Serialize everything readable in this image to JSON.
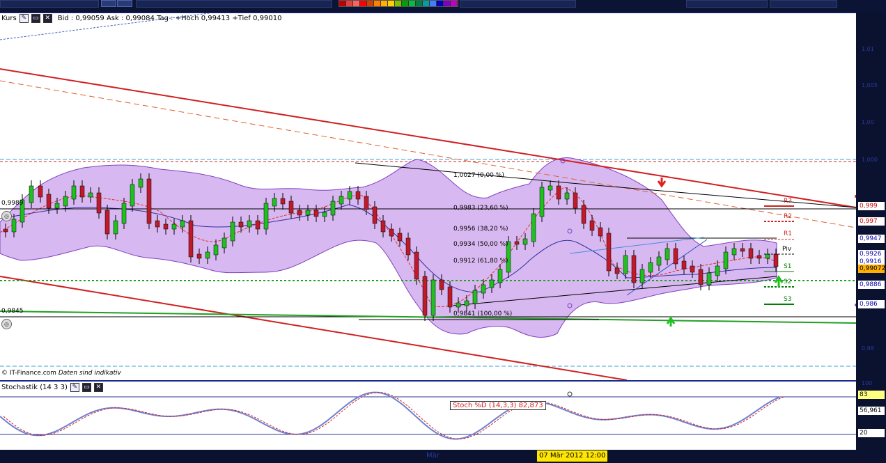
{
  "header": {
    "pane_title": "Kurs",
    "ohlc_text": "Bid : 0,99059 Ask : 0,99084  Tag : +Hoch 0,99413 +Tief 0,99010"
  },
  "icons": [
    "wrench-icon",
    "window-icon",
    "close-icon"
  ],
  "palette_colors": [
    "#c00000",
    "#e04040",
    "#ff6060",
    "#ff0000",
    "#d04000",
    "#ff8000",
    "#ffb000",
    "#ffd000",
    "#80c000",
    "#00a000",
    "#00c040",
    "#008040",
    "#00a0a0",
    "#4080ff",
    "#0000c0",
    "#8000c0",
    "#c000c0"
  ],
  "chart": {
    "price_labels": [
      {
        "text": "0,9989",
        "key": "left_9989"
      },
      {
        "text": "0,9845",
        "key": "left_9845"
      }
    ],
    "fibonacci": [
      {
        "label": "1,0027 (0,00 %)"
      },
      {
        "label": "0,9983 (23,60 %)"
      },
      {
        "label": "0,9956 (38,20 %)"
      },
      {
        "label": "0,9934 (50,00 %)"
      },
      {
        "label": "0,9912 (61,80 %)"
      },
      {
        "label": "0,9841 (100,00 %)"
      }
    ],
    "pivots": [
      {
        "name": "R3",
        "color": "#cc2020"
      },
      {
        "name": "R2",
        "color": "#cc2020"
      },
      {
        "name": "R1",
        "color": "#cc2020"
      },
      {
        "name": "Piv",
        "color": "#000000"
      },
      {
        "name": "S1",
        "color": "#008000"
      },
      {
        "name": "S2",
        "color": "#008000"
      },
      {
        "name": "S3",
        "color": "#008000"
      }
    ],
    "axis_tags": [
      {
        "text": "0,999",
        "bg": "#ffffff",
        "color": "#cc0000"
      },
      {
        "text": "0,997",
        "bg": "#ffffff",
        "color": "#cc0000"
      },
      {
        "text": "0,9947",
        "bg": "#ffffff",
        "color": "#0000aa"
      },
      {
        "text": "0,9926",
        "bg": "#ffffff",
        "color": "#0000aa"
      },
      {
        "text": "0,9916",
        "bg": "#ffffff",
        "color": "#0000aa"
      },
      {
        "text": "0,99072",
        "bg": "#ffb000",
        "color": "#000000"
      },
      {
        "text": "0,9886",
        "bg": "#ffffff",
        "color": "#0000aa"
      },
      {
        "text": "0,986",
        "bg": "#ffffff",
        "color": "#0000aa"
      }
    ],
    "source": "© IT-Finance.com",
    "disclaimer": "Daten sind indikativ"
  },
  "stochastic": {
    "title": "Stochastik (14 3 3)",
    "label": "Stoch %D (14,3,3)    82,873",
    "tags": [
      {
        "text": "83",
        "bg": "#ffff80"
      },
      {
        "text": "56,961",
        "bg": "#ffffff"
      },
      {
        "text": "20",
        "bg": "#ffffff"
      }
    ]
  },
  "xaxis": {
    "highlight": "07 Mär 2012 12:00",
    "month_label": "Mär"
  }
}
